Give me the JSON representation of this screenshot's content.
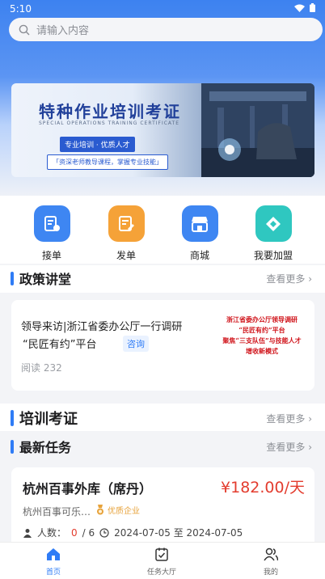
{
  "status": {
    "time": "5:10"
  },
  "search": {
    "placeholder": "请输入内容"
  },
  "banner": {
    "title": "特种作业培训考证",
    "subtitle": "SPECIAL OPERATIONS TRAINING CERTIFICATE",
    "tag": "专业培训 · 优质人才",
    "tag2": "「资深老师教导课程，掌握专业技能」"
  },
  "menu": [
    {
      "label": "接单",
      "icon": "take-order-icon",
      "color": "#3e86f2"
    },
    {
      "label": "发单",
      "icon": "publish-order-icon",
      "color": "#f5a238"
    },
    {
      "label": "商城",
      "icon": "shop-icon",
      "color": "#3e86f2"
    },
    {
      "label": "我要加盟",
      "icon": "join-icon",
      "color": "#2fc7c0"
    }
  ],
  "policy": {
    "title": "政策讲堂",
    "more": "查看更多",
    "card": {
      "line1": "领导来访|浙江省委办公厅一行调研",
      "line2": "“民匠有约”平台",
      "tag": "咨询",
      "reads": "阅读 232",
      "thumb_text": [
        "浙江省委办公厅领导调研",
        "“民匠有约”平台",
        "聚焦“三支队伍”与技能人才",
        "增收新模式"
      ]
    }
  },
  "training": {
    "title": "培训考证",
    "more": "查看更多"
  },
  "tasks": {
    "title": "最新任务",
    "more": "查看更多",
    "card": {
      "name": "杭州百事外库（席丹）",
      "price": "¥182.00/天",
      "company": "杭州百事可乐…",
      "badge": "优质企业",
      "count_label": "人数：",
      "count_value": "0",
      "count_total": "/ 6",
      "dates": "2024-07-05 至 2024-07-05"
    }
  },
  "tabbar": [
    {
      "label": "首页",
      "icon": "home-icon",
      "active": true
    },
    {
      "label": "任务大厅",
      "icon": "task-hall-icon",
      "active": false
    },
    {
      "label": "我的",
      "icon": "profile-icon",
      "active": false
    }
  ],
  "colors": {
    "accent": "#2f7cf6",
    "price": "#e33c2e",
    "header": "#3d82f0"
  }
}
